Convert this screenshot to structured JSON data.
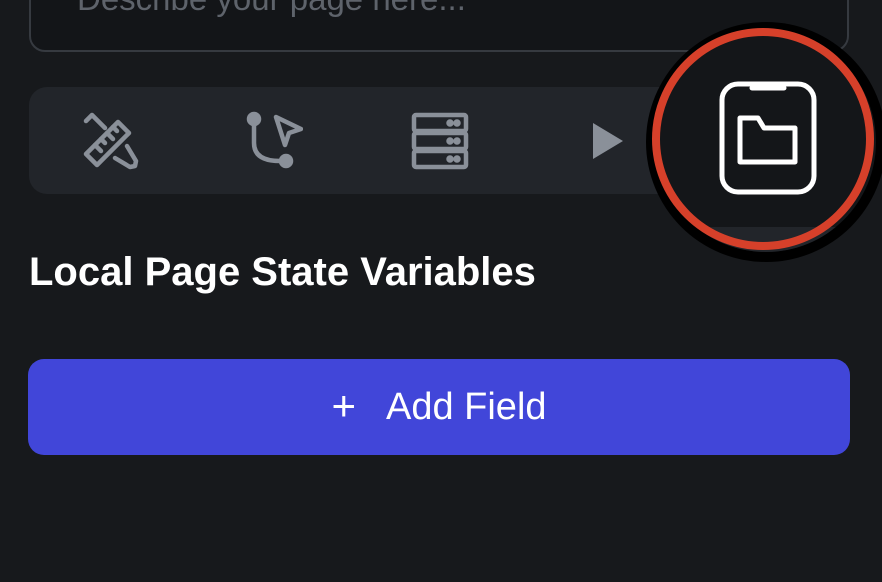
{
  "prompt": {
    "placeholder": "Describe your page here..."
  },
  "toolbar": {
    "items": [
      {
        "icon": "ruler-pencil-icon",
        "label": ""
      },
      {
        "icon": "flow-cursor-icon",
        "label": ""
      },
      {
        "icon": "database-server-icon",
        "label": ""
      },
      {
        "icon": "play-icon",
        "label": ""
      },
      {
        "icon": "page-folder-icon",
        "label": ""
      }
    ],
    "highlighted_item": "page-folder-icon",
    "highlight_color": "#d6402a"
  },
  "section": {
    "title": "Local Page State Variables"
  },
  "add_field": {
    "icon": "+",
    "label": "Add Field",
    "color": "#4146d9"
  }
}
